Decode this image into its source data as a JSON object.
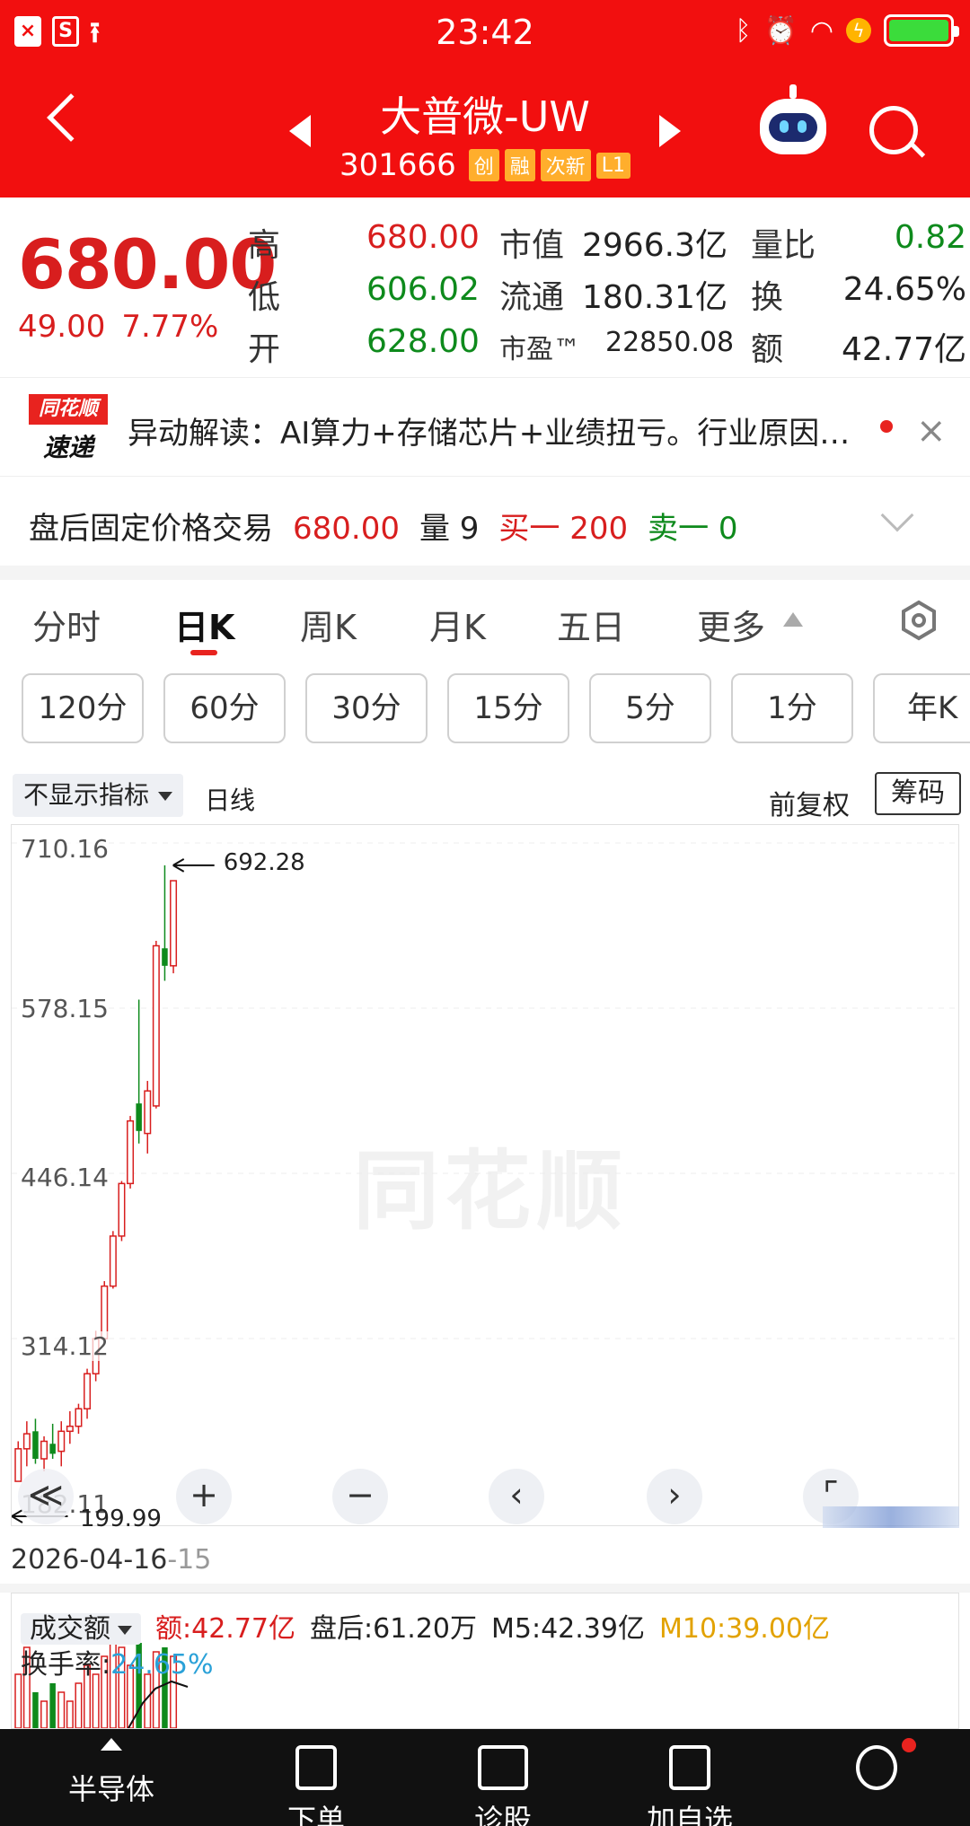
{
  "status_bar": {
    "time": "23:42",
    "left_icons": [
      "close-box-icon",
      "s-box-icon",
      "upload-icon"
    ],
    "right_icons": [
      "bluetooth-icon",
      "alarm-icon",
      "wifi-icon",
      "charging-icon",
      "battery-icon"
    ]
  },
  "header": {
    "stock_name": "大普微-UW",
    "stock_code": "301666",
    "tags": [
      "创",
      "融",
      "次新",
      "L1"
    ]
  },
  "quote": {
    "price": "680.00",
    "change": "49.00",
    "change_pct": "7.77%",
    "rows": [
      [
        {
          "label": "高",
          "value": "680.00",
          "color": "red"
        },
        {
          "label": "市值",
          "value": "2966.3亿"
        },
        {
          "label": "量比",
          "value": "0.82",
          "color": "green"
        }
      ],
      [
        {
          "label": "低",
          "value": "606.02",
          "color": "green"
        },
        {
          "label": "流通",
          "value": "180.31亿"
        },
        {
          "label": "换",
          "value": "24.65%"
        }
      ],
      [
        {
          "label": "开",
          "value": "628.00",
          "color": "green"
        },
        {
          "label": "市盈™",
          "value": "22850.08"
        },
        {
          "label": "额",
          "value": "42.77亿"
        }
      ]
    ]
  },
  "news": {
    "logo_top": "同花顺",
    "logo_bottom": "速递",
    "text": "异动解读：AI算力+存储芯片+业绩扭亏。行业原因…"
  },
  "after_hours": {
    "label": "盘后固定价格交易",
    "price": "680.00",
    "vol_label": "量 9",
    "buy": "买一 200",
    "sell": "卖一 0"
  },
  "tabs": {
    "items": [
      "分时",
      "日K",
      "周K",
      "月K",
      "五日",
      "更多"
    ],
    "active": 1
  },
  "intervals": [
    "120分",
    "60分",
    "30分",
    "15分",
    "5分",
    "1分",
    "年K"
  ],
  "chart_header": {
    "indicator": "不显示指标",
    "kline_type": "日线",
    "adjust": "前复权",
    "chips": "筹码"
  },
  "chart_data": {
    "type": "candlestick",
    "y_labels": [
      "710.16",
      "578.15",
      "446.14",
      "314.12",
      "182.11"
    ],
    "ylim": [
      182.11,
      710.16
    ],
    "high_marker": "692.28",
    "low_marker": "199.99",
    "date_label": "2026-04-16",
    "date_suffix": "-15",
    "watermark": "同花顺",
    "candles": [
      {
        "o": 200,
        "h": 232,
        "l": 199.99,
        "c": 226
      },
      {
        "o": 226,
        "h": 248,
        "l": 212,
        "c": 238
      },
      {
        "o": 240,
        "h": 250,
        "l": 214,
        "c": 218
      },
      {
        "o": 218,
        "h": 236,
        "l": 208,
        "c": 232
      },
      {
        "o": 230,
        "h": 246,
        "l": 218,
        "c": 222
      },
      {
        "o": 224,
        "h": 248,
        "l": 212,
        "c": 240
      },
      {
        "o": 240,
        "h": 256,
        "l": 230,
        "c": 244
      },
      {
        "o": 244,
        "h": 262,
        "l": 238,
        "c": 258
      },
      {
        "o": 258,
        "h": 290,
        "l": 250,
        "c": 286
      },
      {
        "o": 286,
        "h": 320,
        "l": 280,
        "c": 314
      },
      {
        "o": 314,
        "h": 360,
        "l": 312,
        "c": 356
      },
      {
        "o": 356,
        "h": 400,
        "l": 354,
        "c": 396
      },
      {
        "o": 396,
        "h": 440,
        "l": 392,
        "c": 438
      },
      {
        "o": 438,
        "h": 492,
        "l": 434,
        "c": 488
      },
      {
        "o": 502,
        "h": 585,
        "l": 470,
        "c": 480
      },
      {
        "o": 478,
        "h": 520,
        "l": 462,
        "c": 512
      },
      {
        "o": 500,
        "h": 632,
        "l": 498,
        "c": 628
      },
      {
        "o": 626,
        "h": 692.28,
        "l": 600,
        "c": 612
      },
      {
        "o": 612,
        "h": 680,
        "l": 606.02,
        "c": 680
      }
    ]
  },
  "controls": [
    "≪",
    "+",
    "−",
    "‹",
    "›",
    "⌜"
  ],
  "volume": {
    "selector": "成交额",
    "amount": "额:42.77亿",
    "after": "盘后:61.20万",
    "m5": "M5:42.39亿",
    "m10": "M10:39.00亿",
    "turnover_label": "换手率:",
    "turnover_value": "24.65%",
    "bars": [
      0.6,
      0.9,
      0.4,
      0.3,
      0.5,
      0.4,
      0.3,
      0.5,
      0.7,
      0.6,
      0.8,
      1.0,
      0.9,
      0.7,
      0.95,
      0.6,
      0.85,
      0.9,
      0.8
    ]
  },
  "colors": {
    "up": "#d81e1e",
    "down": "#0e8a1c",
    "brand": "#f20f0f",
    "m10": "#e2a200",
    "turnover": "#2aa1d8"
  },
  "bottom_nav": [
    "半导体",
    "下单",
    "诊股",
    "加自选",
    ""
  ]
}
